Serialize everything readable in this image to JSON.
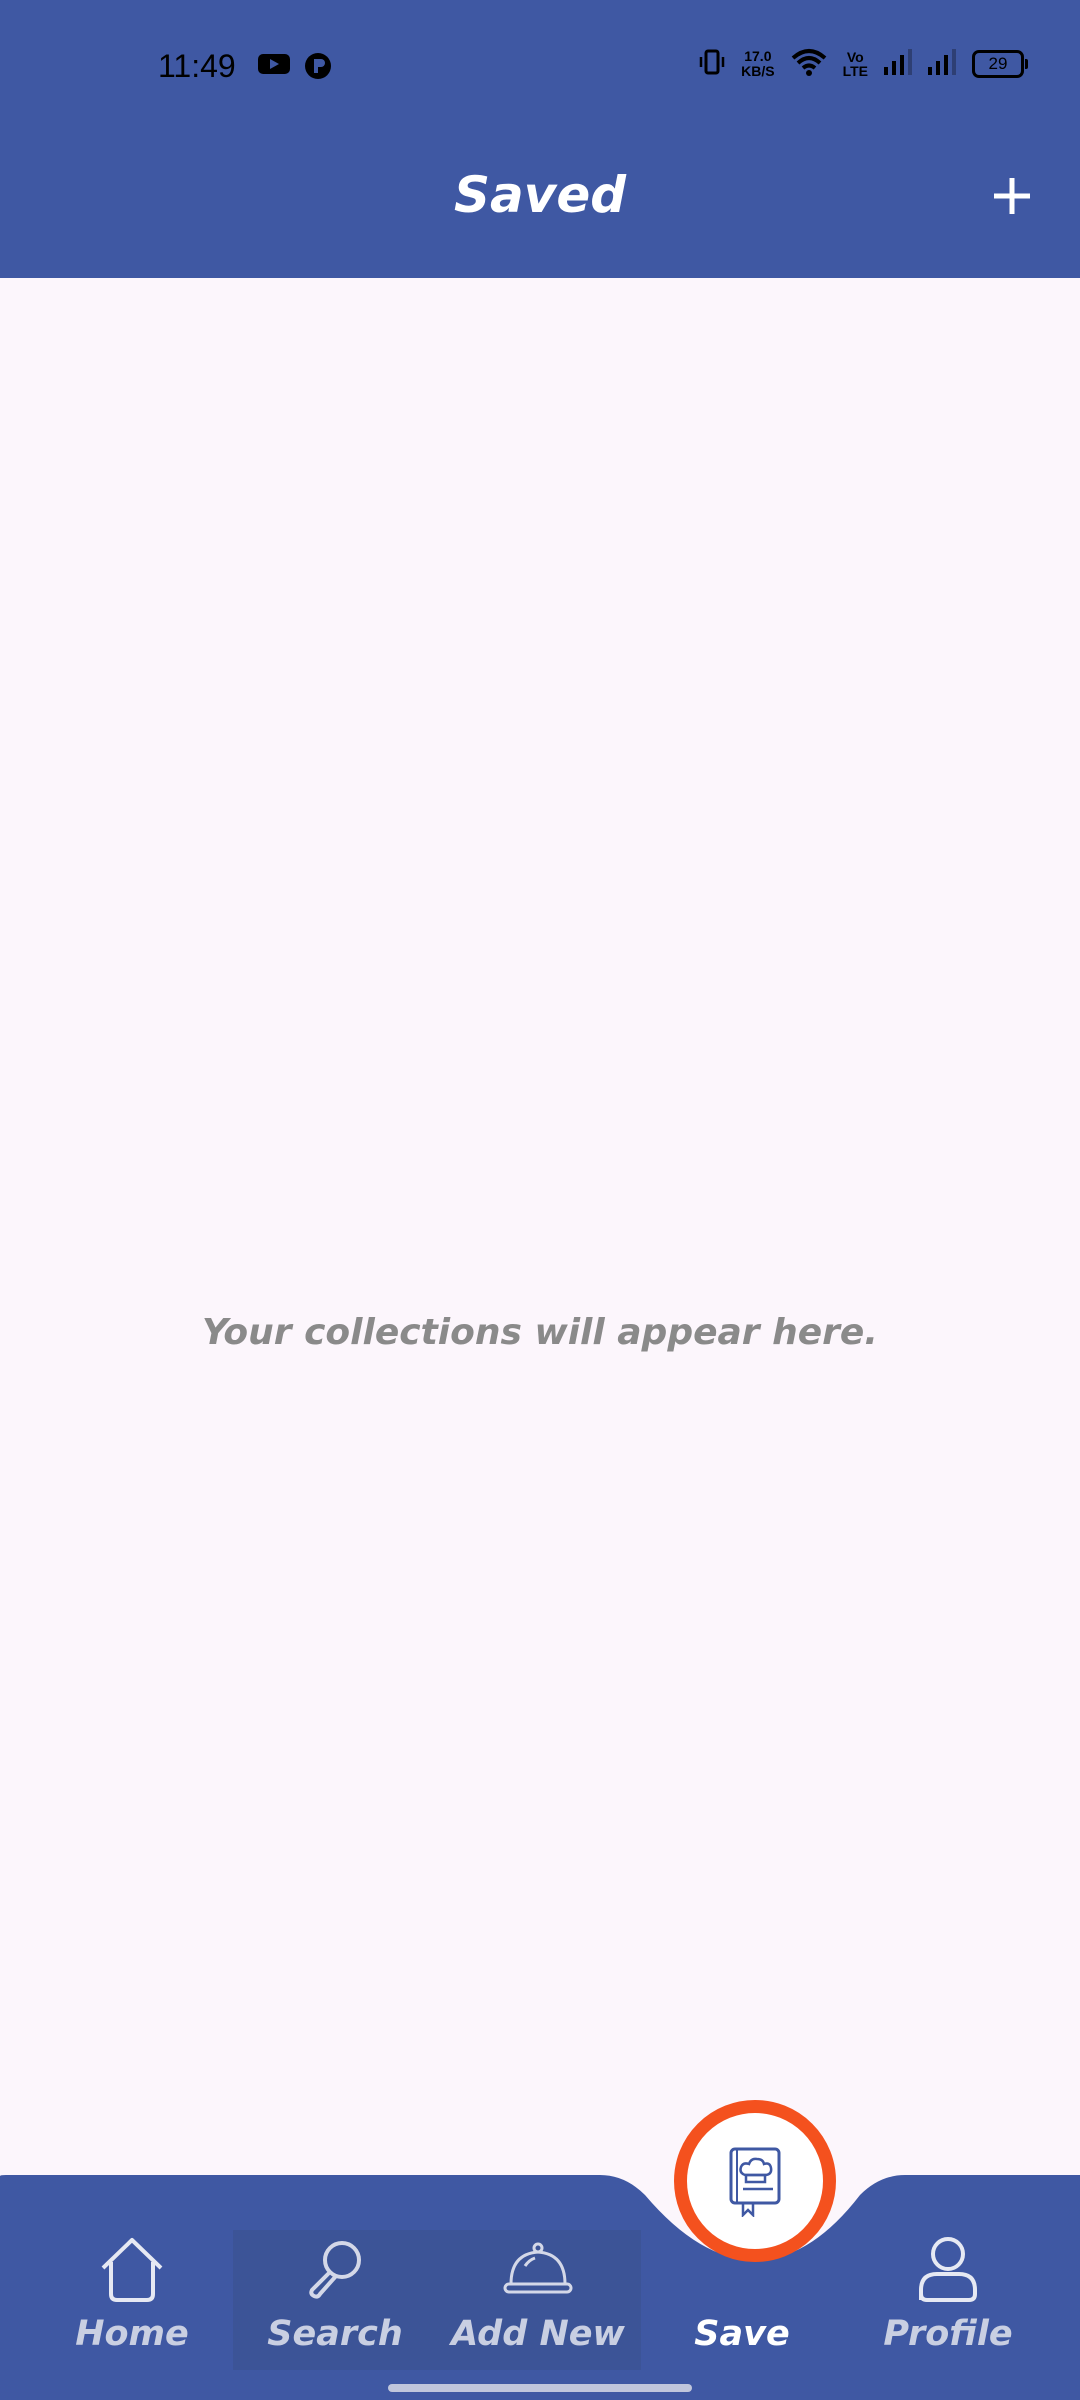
{
  "status_bar": {
    "time": "11:49",
    "net_speed_value": "17.0",
    "net_speed_unit": "KB/S",
    "volte_top": "Vo",
    "volte_bottom": "LTE",
    "battery": "29",
    "icons": [
      "youtube-icon",
      "app-notification-icon",
      "vibrate-icon",
      "wifi-icon",
      "volte-icon",
      "signal-icon",
      "signal-icon",
      "battery-icon"
    ]
  },
  "app_bar": {
    "title": "Saved",
    "action_icon": "plus-icon"
  },
  "main": {
    "empty_message": "Your collections will appear here."
  },
  "bottom_nav": {
    "items": [
      {
        "label": "Home",
        "icon": "home-icon",
        "active": false
      },
      {
        "label": "Search",
        "icon": "search-icon",
        "active": false
      },
      {
        "label": "Add New",
        "icon": "cloche-icon",
        "active": false
      },
      {
        "label": "Save",
        "icon": "recipe-book-icon",
        "active": true
      },
      {
        "label": "Profile",
        "icon": "profile-icon",
        "active": false
      }
    ]
  },
  "colors": {
    "primary": "#3f58a3",
    "background": "#fcf6fc",
    "accent": "#f4511e",
    "muted_text": "#8a8a8a"
  }
}
